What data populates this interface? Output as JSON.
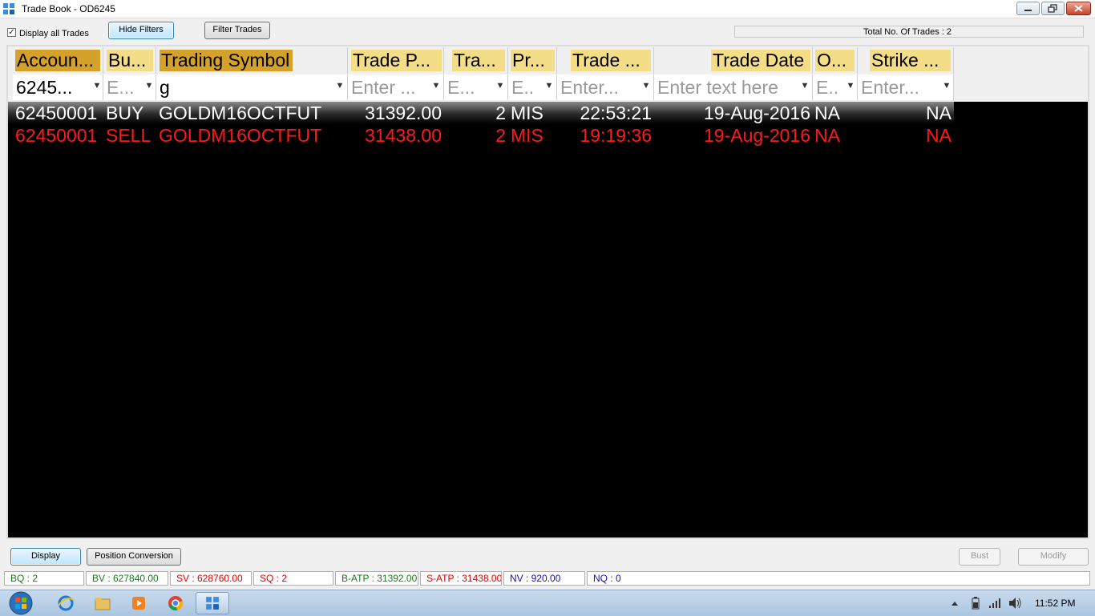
{
  "window": {
    "title": "Trade Book - OD6245"
  },
  "toolbar": {
    "display_all_label": "Display all Trades",
    "display_all_checked": true,
    "hide_filters_label": "Hide Filters",
    "filter_trades_label": "Filter Trades",
    "total_label": "Total No. Of Trades : 2"
  },
  "grid": {
    "columns": [
      {
        "label": "Accoun...",
        "filter": "6245...",
        "filter_has_value": true
      },
      {
        "label": "Bu...",
        "filter": "E...",
        "filter_has_value": false
      },
      {
        "label": "Trading Symbol",
        "filter": "g",
        "filter_has_value": true
      },
      {
        "label": "Trade P...",
        "filter": "Enter ...",
        "filter_has_value": false
      },
      {
        "label": "Tra...",
        "filter": "E...",
        "filter_has_value": false
      },
      {
        "label": "Pr...",
        "filter": "E..",
        "filter_has_value": false
      },
      {
        "label": "Trade ...",
        "filter": "Enter...",
        "filter_has_value": false
      },
      {
        "label": "Trade Date",
        "filter": "Enter text here",
        "filter_has_value": false
      },
      {
        "label": "O...",
        "filter": "E..",
        "filter_has_value": false
      },
      {
        "label": "Strike ...",
        "filter": "Enter...",
        "filter_has_value": false
      }
    ],
    "rows": [
      {
        "account": "62450001",
        "side": "BUY",
        "symbol": "GOLDM16OCTFUT",
        "price": "31392.00",
        "qty": "2",
        "product": "MIS",
        "time": "22:53:21",
        "date": "19-Aug-2016",
        "option": "NA",
        "strike": "NA"
      },
      {
        "account": "62450001",
        "side": "SELL",
        "symbol": "GOLDM16OCTFUT",
        "price": "31438.00",
        "qty": "2",
        "product": "MIS",
        "time": "19:19:36",
        "date": "19-Aug-2016",
        "option": "NA",
        "strike": "NA"
      }
    ]
  },
  "actions": {
    "display_label": "Display",
    "position_conversion_label": "Position Conversion",
    "bust_label": "Bust",
    "modify_label": "Modify"
  },
  "status": {
    "bq": "BQ : 2",
    "bv": "BV : 627840.00",
    "sv": "SV : 628760.00",
    "sq": "SQ : 2",
    "batp": "B-ATP : 31392.00",
    "satp": "S-ATP : 31438.00",
    "nv": "NV : 920.00",
    "nq": "NQ : 0",
    "colors": {
      "green": "#1a7a1a",
      "red": "#e00000",
      "blue": "#1010c0"
    }
  },
  "taskbar": {
    "time": "11:52 PM"
  },
  "colors": {
    "header_gold": "#d4a12a",
    "header_pale": "#f3dd86",
    "grid_bg": "#000000",
    "sell_red": "#ff1a1a"
  }
}
